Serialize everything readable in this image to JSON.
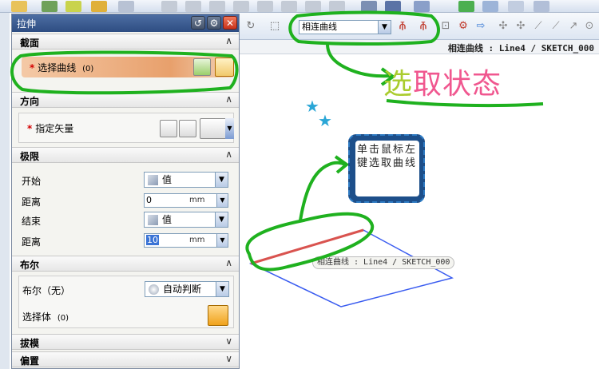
{
  "dialog": {
    "title": "拉伸",
    "sections": {
      "section_profile": {
        "label": "截面",
        "select_curve_label": "选择曲线",
        "select_curve_count": "(0)"
      },
      "section_direction": {
        "label": "方向",
        "vector_label": "指定矢量"
      },
      "section_limits": {
        "label": "极限",
        "start_label": "开始",
        "start_value": "值",
        "start_distance_label": "距离",
        "start_distance": "0",
        "end_label": "结束",
        "end_value": "值",
        "end_distance_label": "距离",
        "end_distance": "10",
        "unit": "mm"
      },
      "section_boolean": {
        "label": "布尔",
        "boolean_label": "布尔（无）",
        "boolean_value": "自动判断",
        "select_body_label": "选择体",
        "select_body_count": "(0)"
      },
      "section_draft": {
        "label": "拔模"
      },
      "section_offset": {
        "label": "偏置"
      }
    }
  },
  "toolbar": {
    "curve_filter": "相连曲线"
  },
  "status": {
    "text": "相连曲线 : Line4 / SKETCH_000"
  },
  "viewport": {
    "tooltip": "相连曲线 : Line4 / SKETCH_000"
  },
  "annotation": {
    "callout_part1": "选",
    "callout_part2": "取状态",
    "note": "单击鼠标左键选取曲线"
  },
  "colors": {
    "highlight_green": "#1fb11f",
    "selected_line": "#d9534f",
    "sketch_blue": "#3a5cf0",
    "title_blue": "#2e4d82"
  }
}
